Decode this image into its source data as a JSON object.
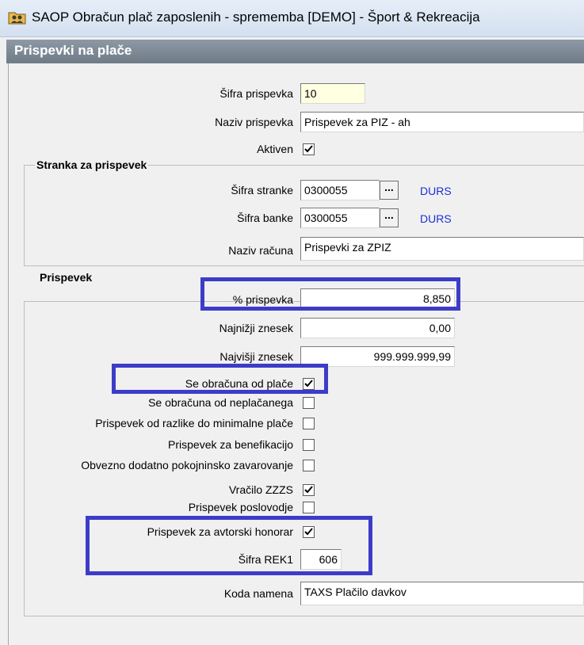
{
  "window": {
    "title": "SAOP Obračun plač zaposlenih - sprememba [DEMO] - Šport & Rekreacija"
  },
  "form": {
    "title": "Prispevki na plače"
  },
  "fields": {
    "sifra_prispevka": {
      "label": "Šifra prispevka",
      "value": "10"
    },
    "naziv_prispevka": {
      "label": "Naziv prispevka",
      "value": "Prispevek za PIZ - ah"
    },
    "aktiven": {
      "label": "Aktiven",
      "checked": true
    }
  },
  "stranka": {
    "group_title": "Stranka za prispevek",
    "sifra_stranke": {
      "label": "Šifra stranke",
      "value": "0300055",
      "link": "DURS"
    },
    "sifra_banke": {
      "label": "Šifra banke",
      "value": "0300055",
      "link": "DURS"
    },
    "naziv_racuna": {
      "label": "Naziv računa",
      "value": "Prispevki za ZPIZ"
    },
    "lookup_button": "..."
  },
  "prispevek": {
    "group_title": "Prispevek",
    "odstotek": {
      "label": "% prispevka",
      "value": "8,850"
    },
    "najnizji": {
      "label": "Najnižji znesek",
      "value": "0,00"
    },
    "najvisji": {
      "label": "Najvišji znesek",
      "value": "999.999.999,99"
    },
    "checks": [
      {
        "label": "Se obračuna od plače",
        "checked": true
      },
      {
        "label": "Se obračuna od neplačanega",
        "checked": false
      },
      {
        "label": "Prispevek od razlike do minimalne plače",
        "checked": false
      },
      {
        "label": "Prispevek za benefikacijo",
        "checked": false
      },
      {
        "label": "Obvezno dodatno pokojninsko zavarovanje",
        "checked": false
      },
      {
        "label": "Vračilo ZZZS",
        "checked": true
      },
      {
        "label": "Prispevek poslovodje",
        "checked": false
      },
      {
        "label": "Prispevek za avtorski honorar",
        "checked": true
      }
    ],
    "sifra_rek1": {
      "label": "Šifra REK1",
      "value": "606"
    },
    "koda_namena": {
      "label": "Koda namena",
      "value": "TAXS Plačilo davkov"
    }
  },
  "colors": {
    "highlight": "#3c3cc8",
    "link": "#1a2fd6",
    "header": "#7a8692"
  },
  "icons": {
    "app": "folder-people-icon",
    "check": "checkmark-icon",
    "lookup": "ellipsis-icon"
  }
}
